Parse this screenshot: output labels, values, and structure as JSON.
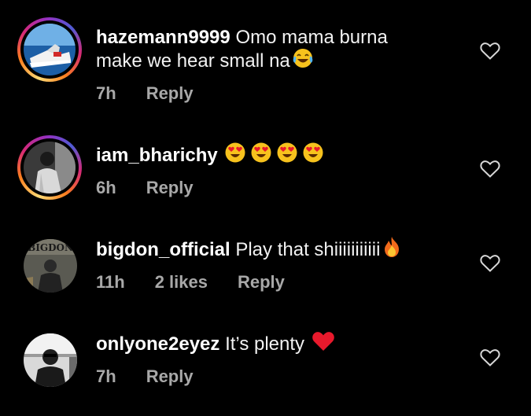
{
  "comments": [
    {
      "username": "hazemann9999",
      "text_line1": "Omo mama burna",
      "text_line2": "make we hear small na",
      "emoji": "face-with-tears-of-joy",
      "time": "7h",
      "likes": "",
      "reply_label": "Reply"
    },
    {
      "username": "iam_bharichy",
      "text_line1": "",
      "emoji": "heart-eyes-x4",
      "time": "6h",
      "likes": "",
      "reply_label": "Reply"
    },
    {
      "username": "bigdon_official",
      "text_line1": "Play that shiiiiiiiiiii",
      "emoji": "fire",
      "avatar_text": "BIGDON",
      "time": "11h",
      "likes": "2 likes",
      "reply_label": "Reply"
    },
    {
      "username": "onlyone2eyez",
      "text_line1": "It’s plenty",
      "emoji": "red-heart",
      "time": "7h",
      "likes": "",
      "reply_label": "Reply"
    }
  ],
  "colors": {
    "background": "#000000",
    "text": "#f2f2f2",
    "meta": "#a8a8a8"
  }
}
